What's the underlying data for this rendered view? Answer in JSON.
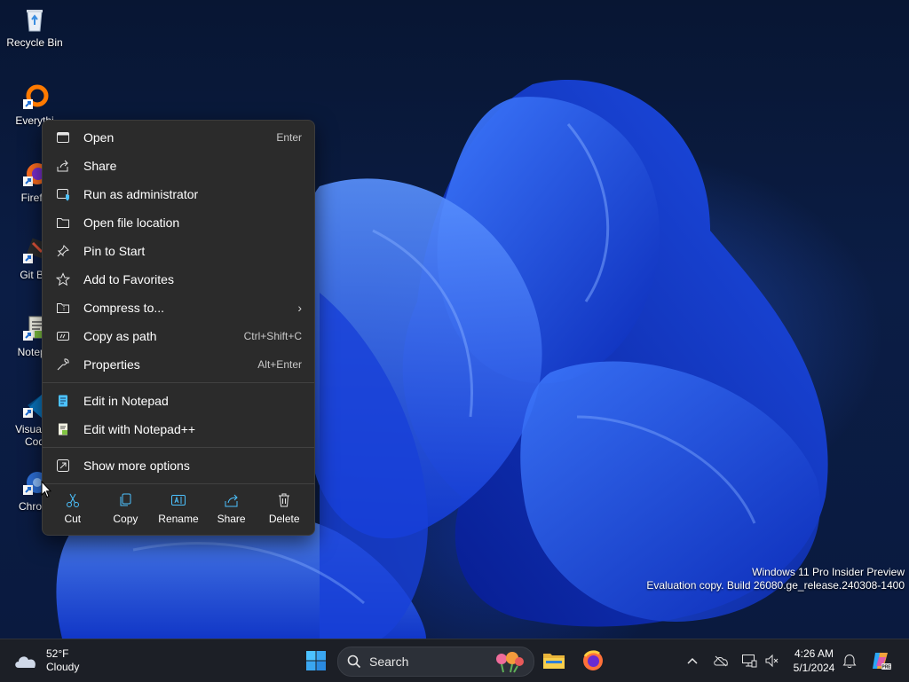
{
  "desktop_icons": [
    {
      "label": "Recycle Bin",
      "icon": "recycle-bin-icon"
    },
    {
      "label": "Everythi",
      "icon": "everything-app-icon"
    },
    {
      "label": "Firefo",
      "icon": "firefox-icon"
    },
    {
      "label": "Git Ba",
      "icon": "git-bash-icon"
    },
    {
      "label": "Notepa",
      "icon": "notepad-plus-plus-icon"
    },
    {
      "label": "Visual S",
      "label2": "Cod",
      "icon": "vscode-icon"
    },
    {
      "label": "Chrom",
      "icon": "chrome-icon"
    }
  ],
  "context_menu": {
    "items": [
      {
        "label": "Open",
        "shortcut": "Enter",
        "icon": "open-icon"
      },
      {
        "label": "Share",
        "shortcut": "",
        "icon": "share-icon"
      },
      {
        "label": "Run as administrator",
        "shortcut": "",
        "icon": "shield-icon"
      },
      {
        "label": "Open file location",
        "shortcut": "",
        "icon": "folder-icon"
      },
      {
        "label": "Pin to Start",
        "shortcut": "",
        "icon": "pin-icon"
      },
      {
        "label": "Add to Favorites",
        "shortcut": "",
        "icon": "star-icon"
      },
      {
        "label": "Compress to...",
        "shortcut": "",
        "icon": "zip-folder-icon",
        "submenu": true
      },
      {
        "label": "Copy as path",
        "shortcut": "Ctrl+Shift+C",
        "icon": "copy-path-icon"
      },
      {
        "label": "Properties",
        "shortcut": "Alt+Enter",
        "icon": "wrench-icon"
      }
    ],
    "app_items": [
      {
        "label": "Edit in Notepad",
        "icon": "notepad-icon"
      },
      {
        "label": "Edit with Notepad++",
        "icon": "notepad-plus-plus-icon"
      }
    ],
    "more": {
      "label": "Show more options",
      "icon": "more-options-icon"
    },
    "quick_actions": [
      {
        "label": "Cut",
        "icon": "scissors-icon"
      },
      {
        "label": "Copy",
        "icon": "copy-icon"
      },
      {
        "label": "Rename",
        "icon": "rename-icon"
      },
      {
        "label": "Share",
        "icon": "share-icon"
      },
      {
        "label": "Delete",
        "icon": "trash-icon"
      }
    ]
  },
  "watermark": {
    "line1": "Windows 11 Pro Insider Preview",
    "line2": "Evaluation copy. Build 26080.ge_release.240308-1400"
  },
  "taskbar": {
    "weather": {
      "temp": "52°F",
      "condition": "Cloudy",
      "icon": "cloud-icon"
    },
    "search_placeholder": "Search",
    "pinned": [
      "start-icon",
      "file-explorer-icon",
      "firefox-icon"
    ],
    "tray_icons": [
      "chevron-up-icon",
      "onedrive-icon",
      "network-icon",
      "volume-icon",
      "notification-bell-icon",
      "copilot-icon"
    ],
    "time": "4:26 AM",
    "date": "5/1/2024"
  },
  "colors": {
    "menu_bg": "#2b2b2b",
    "taskbar_bg": "#1c1f26",
    "accent": "#4cc2ff"
  }
}
